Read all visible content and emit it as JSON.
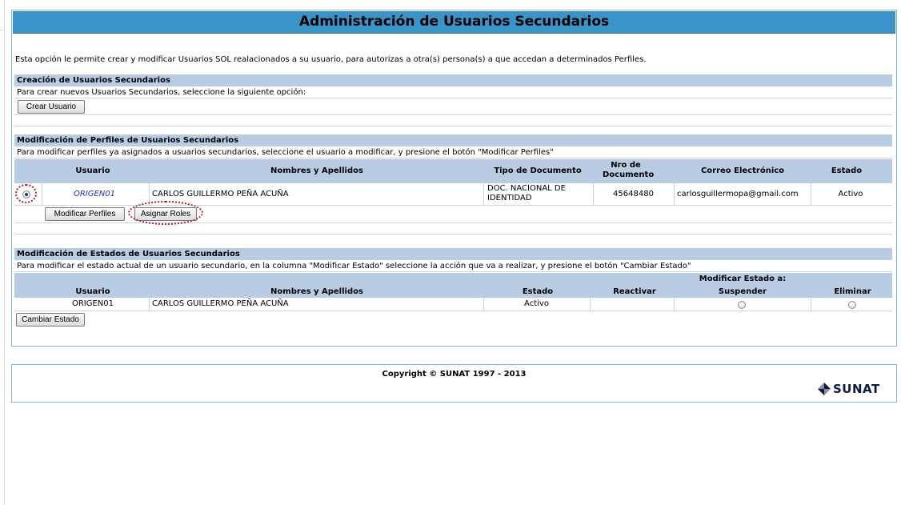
{
  "title": "Administración de Usuarios Secundarios",
  "intro": "Esta opción le permite crear y modificar Usuarios SOL realacionados a su usuario, para autorizas a otra(s) persona(s) a que accedan a determinados Perfiles.",
  "creation": {
    "heading": "Creación de Usuarios Secundarios",
    "instruction": "Para crear nuevos Usuarios Secundarios, seleccione la siguiente opción:",
    "button": "Crear Usuario"
  },
  "profiles": {
    "heading": "Modificación de Perfiles de Usuarios Secundarios",
    "instruction": "Para modificar perfiles ya asignados a usuarios secundarios, seleccione el usuario a modificar, y presione el botón \"Modificar Perfiles\"",
    "columns": {
      "usuario": "Usuario",
      "nombres": "Nombres y Apellidos",
      "tipo_doc": "Tipo de Documento",
      "nro_doc": "Nro de Documento",
      "correo": "Correo Electrónico",
      "estado": "Estado"
    },
    "row": {
      "usuario": "ORIGEN01",
      "nombres": "CARLOS GUILLERMO  PEÑA ACUÑA",
      "tipo_doc": "DOC. NACIONAL DE IDENTIDAD",
      "nro_doc": "45648480",
      "correo": "carlosguillermopa@gmail.com",
      "estado": "Activo",
      "selected": true
    },
    "buttons": {
      "modify": "Modificar Perfiles",
      "assign": "Asignar Roles"
    }
  },
  "states": {
    "heading": "Modificación de Estados de Usuarios Secundarios",
    "instruction": "Para modificar el estado actual de un usuario secundario, en la columna \"Modificar Estado\" seleccione la acción que va a realizar, y presione el botón \"Cambiar Estado\"",
    "group_header": "Modificar Estado a:",
    "columns": {
      "usuario": "Usuario",
      "nombres": "Nombres y Apellidos",
      "estado": "Estado",
      "reactivar": "Reactivar",
      "suspender": "Suspender",
      "eliminar": "Eliminar"
    },
    "row": {
      "usuario": "ORIGEN01",
      "nombres": "CARLOS GUILLERMO  PEÑA ACUÑA",
      "estado": "Activo",
      "reactivar": "",
      "suspender_selected": false,
      "eliminar_selected": false
    },
    "button": "Cambiar Estado"
  },
  "footer": {
    "copyright": "Copyright © SUNAT 1997 - 2013",
    "logo_text": "SUNAT"
  },
  "colors": {
    "title_bar": "#3a93c9",
    "section_header": "#b8cce4",
    "highlight": "#c0181f",
    "link": "#1a35c9"
  }
}
